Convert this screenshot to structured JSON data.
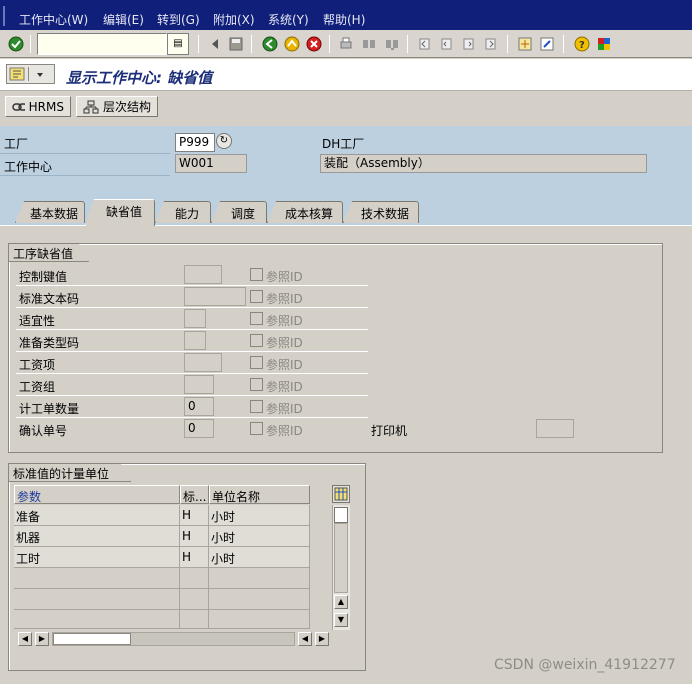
{
  "menubar": {
    "items": [
      "工作中心(W)",
      "编辑(E)",
      "转到(G)",
      "附加(X)",
      "系统(Y)",
      "帮助(H)"
    ]
  },
  "toolbar": {
    "command_value": "",
    "icons": [
      "enter-check",
      "save",
      "back",
      "exit",
      "cancel",
      "print",
      "find",
      "find-next",
      "first-page",
      "previous-page",
      "next-page",
      "last-page",
      "new-session",
      "shortcut",
      "help",
      "customize-layout"
    ]
  },
  "title": {
    "text": "显示工作中心: 缺省值"
  },
  "app_toolbar": {
    "hrms_label": "HRMS",
    "hierarchy_label": "层次结构"
  },
  "header": {
    "plant_label": "工厂",
    "plant_value": "P999",
    "plant_desc": "DH工厂",
    "workcenter_label": "工作中心",
    "workcenter_value": "W001",
    "workcenter_desc": "装配（Assembly）"
  },
  "tabs": [
    "基本数据",
    "缺省值",
    "能力",
    "调度",
    "成本核算",
    "技术数据"
  ],
  "active_tab": "缺省值",
  "operation_defaults": {
    "title": "工序缺省值",
    "reference_label": "参照ID",
    "fields": [
      {
        "label": "控制键值",
        "value": ""
      },
      {
        "label": "标准文本码",
        "value": ""
      },
      {
        "label": "适宜性",
        "value": ""
      },
      {
        "label": "准备类型码",
        "value": ""
      },
      {
        "label": "工资项",
        "value": ""
      },
      {
        "label": "工资组",
        "value": ""
      },
      {
        "label": "计工单数量",
        "value": "0"
      },
      {
        "label": "确认单号",
        "value": "0"
      }
    ],
    "printer_label": "打印机",
    "printer_value": ""
  },
  "units_table": {
    "title": "标准值的计量单位",
    "columns": [
      "参数",
      "标...",
      "单位名称"
    ],
    "rows": [
      {
        "param": "准备",
        "unit": "H",
        "unit_name": "小时"
      },
      {
        "param": "机器",
        "unit": "H",
        "unit_name": "小时"
      },
      {
        "param": "工时",
        "unit": "H",
        "unit_name": "小时"
      }
    ]
  },
  "watermark": "CSDN @weixin_41912277",
  "colors": {
    "menubar_bg": "#0f1f7a",
    "title_text": "#1c2e7a",
    "header_bg": "#bdd0e0",
    "panel_bg": "#d4d0c8"
  }
}
